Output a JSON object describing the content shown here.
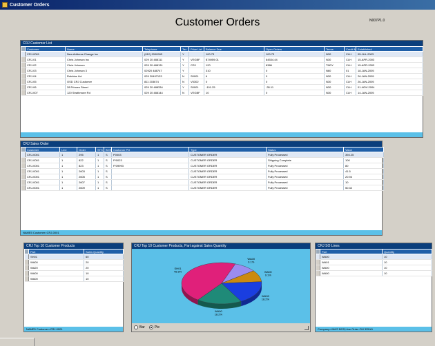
{
  "window": {
    "title": "Customer Orders",
    "heading": "Customer Orders",
    "version": "N007P1.0"
  },
  "customer_list": {
    "title": "CRJ Customer List",
    "columns": [
      "Customer",
      "Name",
      "Telephone",
      "Tax",
      "Price List",
      "Balance Due",
      "Open Orders",
      "Terms",
      "Credit Me",
      "Established"
    ],
    "rows": [
      [
        "CRJ-0001",
        "New Address Change Inc",
        "(012) 2000993",
        "Y",
        "",
        "100.73",
        "100.73",
        "N30",
        "CLH",
        "05-JUL-2003"
      ],
      [
        "CRJ-01",
        "Chris Johnson Inc",
        "029 20 488111",
        "Y",
        "VEGBF",
        "$74959.01",
        "84534.44",
        "N30",
        "CLH",
        "15-APR-2003"
      ],
      [
        "CRJ-02",
        "Chris Johnson",
        "029 20 488131",
        "Y",
        "CRJ",
        "120",
        "8386",
        "TNDY",
        "CLH",
        "15-APR-2003"
      ],
      [
        "CRJ-03",
        "Chris Johnson 3",
        "02920 488747",
        "Y",
        "",
        "310",
        "0",
        "N60",
        "01",
        "18-JAN-2005"
      ],
      [
        "CRJ-04",
        "Robbins Ltd",
        "029 20497133",
        "N",
        "S0001",
        "6",
        "0",
        "N30",
        "CLH",
        "26-JAN-2005"
      ],
      [
        "CRJ-05",
        "OSD CRJ Customer",
        "811 203674",
        "N",
        "V5302",
        "0",
        "0",
        "N30",
        "CLH",
        "26-JAN-2005"
      ],
      [
        "CRJ-06",
        "28 Princes Street",
        "029 20 488334",
        "Y",
        "S0001",
        "-101.25",
        "-35.11",
        "N30",
        "CLH",
        "01-NOV-2004"
      ],
      [
        "CRJ-007",
        "120 Strathmore Rd",
        "029 20 488144",
        "N",
        "VEGBF",
        "10",
        "0",
        "N30",
        "CLH",
        "14-JAN-2005"
      ]
    ]
  },
  "sales_orders": {
    "title": "CRJ Sales Order",
    "columns": [
      "Customer",
      "Line",
      "Order",
      "STS",
      "BOS",
      "Customer PO",
      "Type",
      "Status",
      "Value"
    ],
    "rows": [
      [
        "CRJ-0001",
        "1",
        "295",
        "1",
        "S",
        "P0003",
        "CUSTOMER ORDER",
        "Fully Processed",
        "394.25"
      ],
      [
        "CRJ-0001",
        "1",
        "822",
        "1",
        "S",
        "P/0023",
        "CUSTOMER ORDER",
        "Shipping Complete",
        "100"
      ],
      [
        "CRJ-0001",
        "1",
        "823",
        "1",
        "S",
        "P/39993",
        "CUSTOMER ORDER",
        "Fully Processed",
        "80"
      ],
      [
        "CRJ-0001",
        "1",
        "2603",
        "1",
        "S",
        "",
        "CUSTOMER ORDER",
        "Fully Processed",
        "41.5"
      ],
      [
        "CRJ-0001",
        "1",
        "2605",
        "1",
        "S",
        "",
        "CUSTOMER ORDER",
        "Fully Processed",
        "20.94"
      ],
      [
        "CRJ-0001",
        "1",
        "2607",
        "1",
        "S",
        "",
        "CUSTOMER ORDER",
        "Fully Processed",
        "10"
      ],
      [
        "CRJ-0001",
        "1",
        "2609",
        "1",
        "S",
        "",
        "CUSTOMER ORDER",
        "Fully Processed",
        "50.32"
      ]
    ],
    "footer": "NAME5 Customer=CRJ-0001"
  },
  "top_products": {
    "title": "CRJ Top 10 Customer Products",
    "columns": [
      "Part",
      "Sales Quantity"
    ],
    "rows": [
      [
        "SH01",
        "60"
      ],
      [
        "WA00",
        "20"
      ],
      [
        "WA20",
        "20"
      ],
      [
        "WA00",
        "10"
      ],
      [
        "WA00",
        "10"
      ]
    ],
    "footer": "NAME5 Customer=CRJ-0001"
  },
  "pie_panel": {
    "title": "CRJ Top 10 Customer Products, Part against Sales Quantity",
    "radio_options": [
      "Bar",
      "Pie"
    ],
    "selected": "Pie"
  },
  "chart_data": {
    "type": "pie",
    "title": "CRJ Top 10 Customer Products, Part against Sales Quantity",
    "slices": [
      {
        "label": "WA00 9.1%",
        "value": 9.1,
        "color": "#9b8cf0"
      },
      {
        "label": "WA00 9.1%",
        "value": 9.1,
        "color": "#cc8a10"
      },
      {
        "label": "WA00 18.2%",
        "value": 18.2,
        "color": "#1a3ee0"
      },
      {
        "label": "WA00 18.2%",
        "value": 18.2,
        "color": "#1f8a78"
      },
      {
        "label": "SH01 45.5%",
        "value": 45.5,
        "color": "#e0207a"
      }
    ]
  },
  "so_lines": {
    "title": "CRJ SO Lines",
    "columns": [
      "Part",
      "Quantity"
    ],
    "rows": [
      [
        "WA00",
        "10"
      ],
      [
        "WA01",
        "10"
      ],
      [
        "WA00",
        "10"
      ],
      [
        "WA00",
        "10"
      ]
    ],
    "footer": "Company=VAKS BOS;Line Order CM 325/#1"
  }
}
